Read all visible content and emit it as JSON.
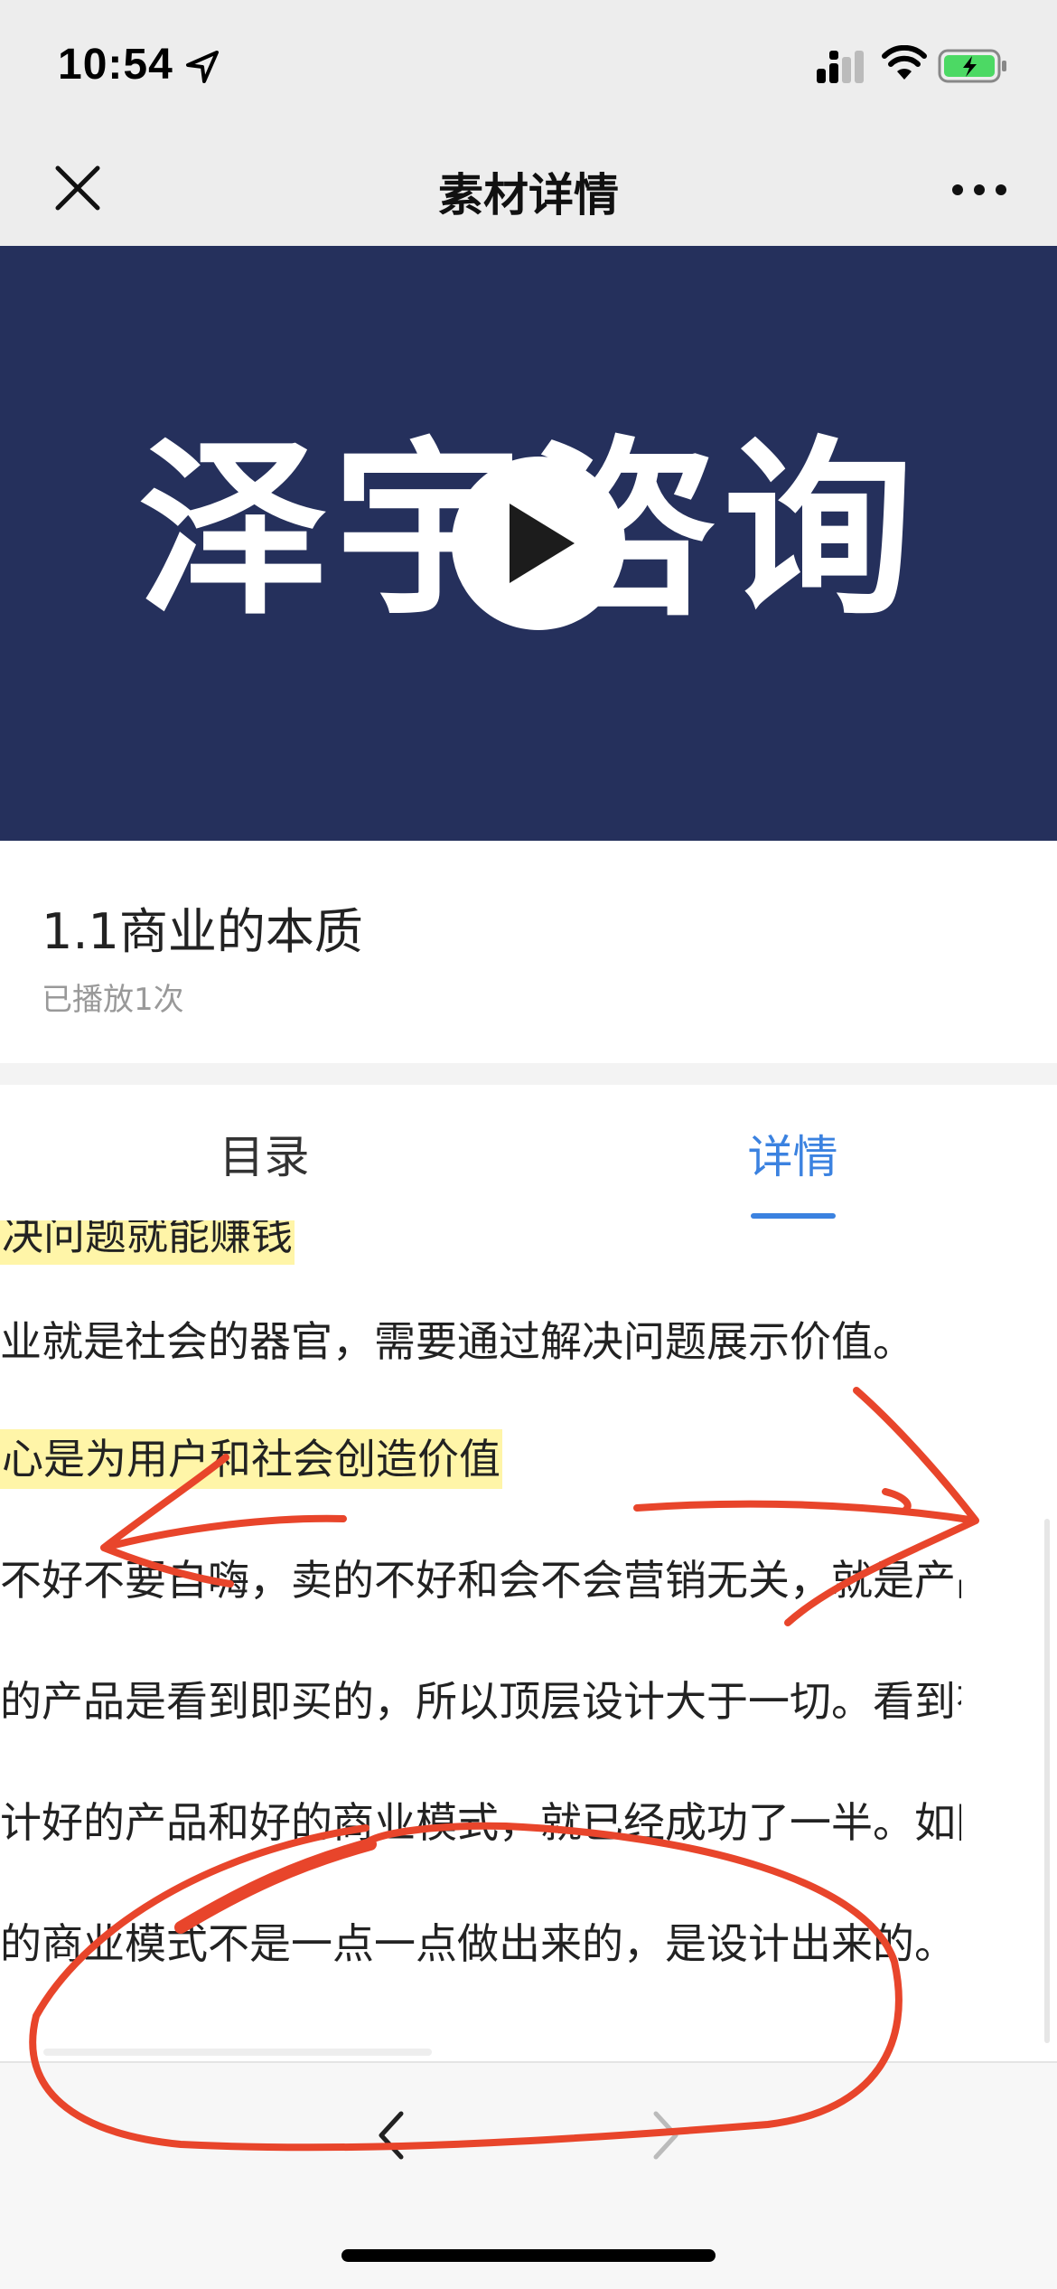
{
  "status_bar": {
    "time": "10:54"
  },
  "nav": {
    "title": "素材详情"
  },
  "video": {
    "logo_text": "泽宇咨询"
  },
  "item": {
    "title": "1.1商业的本质",
    "plays": "已播放1次"
  },
  "tabs": {
    "catalog": "目录",
    "details": "详情",
    "active": "详情"
  },
  "content": {
    "lines": [
      "决问题就能赚钱",
      "业就是社会的器官，需要通过解决问题展示价值。",
      "心是为用户和社会创造价值",
      "不好不要自嗨，卖的不好和会不会营销无关，就是产品垃",
      "的产品是看到即买的，所以顶层设计大于一切。看到有需",
      "计好的产品和好的商业模式，就已经成功了一半。如同盖",
      "的商业模式不是一点一点做出来的，是设计出来的。"
    ]
  },
  "colors": {
    "video_bg": "#25305c",
    "accent": "#3b82e0",
    "highlight": "#fff5a8",
    "annotation": "#e8452b"
  },
  "icons": {
    "close": "close-icon",
    "more": "more-icon",
    "play": "play-icon",
    "back": "chevron-left-icon",
    "forward": "chevron-right-icon"
  }
}
